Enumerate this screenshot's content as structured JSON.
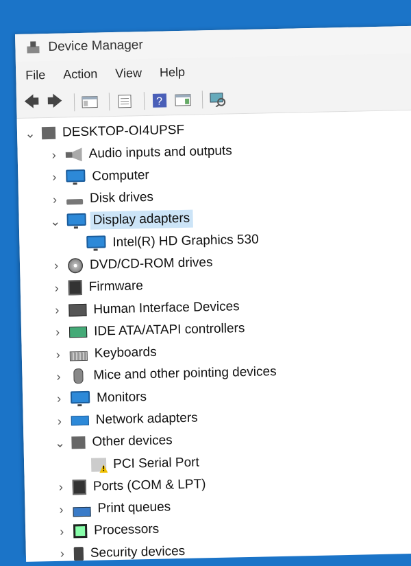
{
  "window": {
    "title": "Device Manager"
  },
  "menu": {
    "file": "File",
    "action": "Action",
    "view": "View",
    "help": "Help"
  },
  "tree": {
    "root": "DESKTOP-OI4UPSF",
    "items": [
      {
        "label": "Audio inputs and outputs",
        "icon": "speaker-icon",
        "expanded": false
      },
      {
        "label": "Computer",
        "icon": "monitor-icon",
        "expanded": false
      },
      {
        "label": "Disk drives",
        "icon": "disk-icon",
        "expanded": false
      },
      {
        "label": "Display adapters",
        "icon": "display-adapter-icon",
        "expanded": true,
        "selected": true,
        "children": [
          "Intel(R) HD Graphics 530"
        ]
      },
      {
        "label": "DVD/CD-ROM drives",
        "icon": "dvd-icon",
        "expanded": false
      },
      {
        "label": "Firmware",
        "icon": "chip-icon",
        "expanded": false
      },
      {
        "label": "Human Interface Devices",
        "icon": "hid-icon",
        "expanded": false
      },
      {
        "label": "IDE ATA/ATAPI controllers",
        "icon": "ide-icon",
        "expanded": false
      },
      {
        "label": "Keyboards",
        "icon": "keyboard-icon",
        "expanded": false
      },
      {
        "label": "Mice and other pointing devices",
        "icon": "mouse-icon",
        "expanded": false
      },
      {
        "label": "Monitors",
        "icon": "monitor-icon",
        "expanded": false
      },
      {
        "label": "Network adapters",
        "icon": "network-icon",
        "expanded": false
      },
      {
        "label": "Other devices",
        "icon": "unknown-device-icon",
        "expanded": true,
        "children": [
          "PCI Serial Port"
        ]
      },
      {
        "label": "Ports (COM & LPT)",
        "icon": "port-icon",
        "expanded": false
      },
      {
        "label": "Print queues",
        "icon": "printer-icon",
        "expanded": false
      },
      {
        "label": "Processors",
        "icon": "cpu-icon",
        "expanded": false
      },
      {
        "label": "Security devices",
        "icon": "security-icon",
        "expanded": false
      }
    ]
  }
}
